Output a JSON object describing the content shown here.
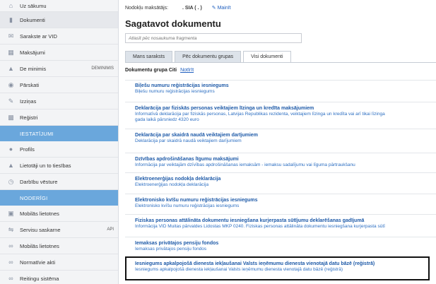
{
  "sidebar": {
    "items": [
      {
        "label": "Uz sākumu",
        "icon": "home-icon"
      },
      {
        "label": "Dokumenti",
        "icon": "document-icon",
        "active": true
      },
      {
        "label": "Sarakste ar VID",
        "icon": "mail-icon"
      },
      {
        "label": "Maksājumi",
        "icon": "payments-icon"
      },
      {
        "label": "De minimis",
        "icon": "warning-icon",
        "extra": "DEMINIMIS"
      },
      {
        "label": "Pārskati",
        "icon": "chart-icon"
      },
      {
        "label": "Izziņas",
        "icon": "edit-icon"
      },
      {
        "label": "Reģistri",
        "icon": "grid-icon"
      }
    ],
    "section_1": "IESTATĪJUMI",
    "items_2": [
      {
        "label": "Profils",
        "icon": "user-icon"
      },
      {
        "label": "Lietotāji un to tiesības",
        "icon": "users-icon"
      },
      {
        "label": "Darbību vēsture",
        "icon": "history-icon"
      }
    ],
    "section_2": "NODERĪGI",
    "items_3": [
      {
        "label": "Mobilās lietotnes",
        "icon": "mobile-icon"
      },
      {
        "label": "Servisu saskarne",
        "icon": "api-icon",
        "extra": "API"
      },
      {
        "label": "Mobilās lietotnes",
        "icon": "link-icon"
      },
      {
        "label": "Normatīvie akti",
        "icon": "link-icon"
      },
      {
        "label": "Reitingu sistēma",
        "icon": "link-icon"
      }
    ]
  },
  "header": {
    "taxpayer_label": "Nodokļu maksātājs:",
    "taxpayer_name": ". SIA (          .   )",
    "change_label": "Mainīt"
  },
  "main": {
    "title": "Sagatavot dokumentu",
    "search_placeholder": "Atlasīt pēc nosaukuma fragmenta",
    "tabs": [
      {
        "label": "Mans saraksts"
      },
      {
        "label": "Pēc dokumentu grupas"
      },
      {
        "label": "Visi dokumenti",
        "active": true
      }
    ],
    "group_label": "Dokumentu grupa Citi",
    "group_reset": "Notīrīt",
    "documents": [
      {
        "title": "Biļešu numuru reģistrācijas iesniegums",
        "desc": "Biļešu numuru reģistrācijas iesniegums"
      },
      {
        "title": "Deklarācija par fiziskās personas veiktajiem līzinga un kredīta maksājumiem",
        "desc": "Informatīvā deklarācija par fiziskās personas, Latvijas Republikas rezidenta, veiktajiem līzinga un kredīta vai arī tikai līzinga",
        "desc2": "gada laikā pārsniedz 4320 euro"
      },
      {
        "title": "Deklarācija par skaidrā naudā veiktajiem darījumiem",
        "desc": "Deklarācija par skaidrā naudā veiktajiem darījumiem"
      },
      {
        "title": "Dzīvības apdrošināšanas līgumu maksājumi",
        "desc": "Informācija par veiktajām dzīvības apdrošināšanas iemaksām - iemaksu sadalījumu vai līguma pārtraukšanu"
      },
      {
        "title": "Elektroenerģijas nodokļa deklarācija",
        "desc": "Elektroenerģijas nodokļa deklarācija"
      },
      {
        "title": "Elektronisko kvīšu numuru reģistrācijas iesniegums",
        "desc": "Elektronisko kvīšu numuru reģistrācijas iesniegums"
      },
      {
        "title": "Fiziskas personas attālināta dokumentu iesniegšana kurjerpasta sūtījumu deklarēšanas gadījumā",
        "desc": "Informācija VID Muitas pārvaldes Lidostas MKP 0240. Fiziskas personas attālināta dokumentu iesniegšana kurjerpasta sūtī"
      },
      {
        "title": "Iemaksas privātajos pensiju fondos",
        "desc": "Iemaksas privātajos pensiju fondos"
      },
      {
        "title": "Iesniegums apkalpojošā dienesta iekļaušanai Valsts ieņēmumu dienesta vienotajā datu bāzē (reģistrā)",
        "desc": "Iesniegums apkalpojošā dienesta iekļaušanai Valsts ieņēmumu dienesta vienotajā datu bāzē (reģistrā)"
      }
    ]
  },
  "colors": {
    "accent": "#6aa7dc",
    "link": "#1e5aa8"
  }
}
